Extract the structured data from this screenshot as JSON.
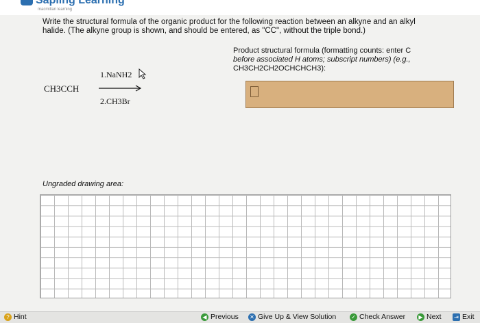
{
  "header": {
    "brand": "Sapling Learning",
    "brand_sub": "macmillan learning"
  },
  "question": {
    "line1": "Write the structural formula of the organic product for the following reaction between an alkyne and an alkyl",
    "line2": "halide. (The alkyne group is shown, and should be entered, as \"CC\", without the triple bond.)"
  },
  "reaction": {
    "reactant": "CH3CCH",
    "reagent1": "1.NaNH2",
    "reagent2": "2.CH3Br"
  },
  "answer": {
    "instr_line1": "Product structural formula (formatting counts: enter C",
    "instr_line2": "before associated H atoms; subscript numbers) (e.g.,",
    "instr_line3": "CH3CH2CH2OCHCHCH3):",
    "value": ""
  },
  "drawing": {
    "label": "Ungraded drawing area:"
  },
  "footer": {
    "hint": "Hint",
    "previous": "Previous",
    "give_up": "Give Up & View Solution",
    "check": "Check Answer",
    "next": "Next",
    "exit": "Exit"
  },
  "colors": {
    "answer_box": "#d8b07e",
    "brand": "#2c6fb0",
    "nav_green": "#3a9a3a"
  }
}
